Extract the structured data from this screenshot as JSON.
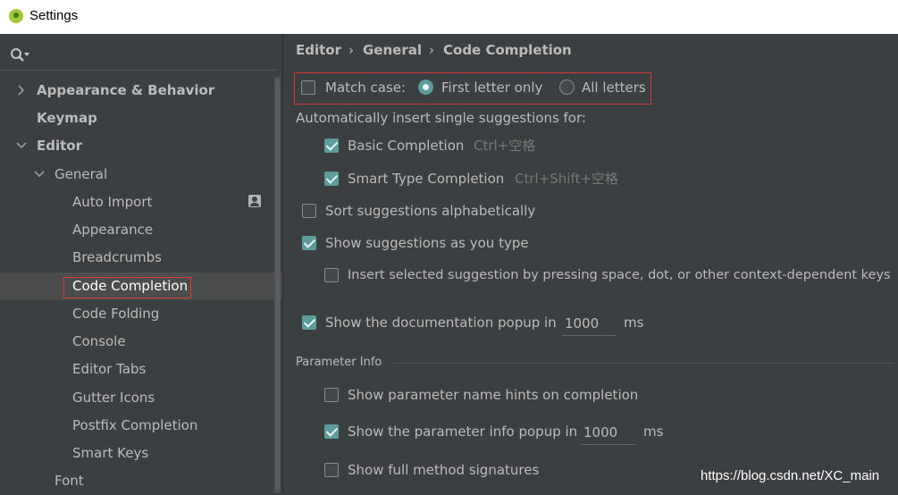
{
  "window": {
    "title": "Settings"
  },
  "sidebar": {
    "items": [
      {
        "label": "Appearance & Behavior"
      },
      {
        "label": "Keymap"
      },
      {
        "label": "Editor"
      },
      {
        "label": "General"
      },
      {
        "label": "Auto Import"
      },
      {
        "label": "Appearance"
      },
      {
        "label": "Breadcrumbs"
      },
      {
        "label": "Code Completion"
      },
      {
        "label": "Code Folding"
      },
      {
        "label": "Console"
      },
      {
        "label": "Editor Tabs"
      },
      {
        "label": "Gutter Icons"
      },
      {
        "label": "Postfix Completion"
      },
      {
        "label": "Smart Keys"
      },
      {
        "label": "Font"
      }
    ],
    "selected": "Code Completion"
  },
  "breadcrumb": [
    "Editor",
    "General",
    "Code Completion"
  ],
  "match_case": {
    "label": "Match case:",
    "checked": false,
    "options": [
      "First letter only",
      "All letters"
    ],
    "selected": "First letter only"
  },
  "auto_insert": {
    "label": "Automatically insert single suggestions for:",
    "basic": {
      "label": "Basic Completion",
      "shortcut": "Ctrl+空格",
      "checked": true
    },
    "smart": {
      "label": "Smart Type Completion",
      "shortcut": "Ctrl+Shift+空格",
      "checked": true
    }
  },
  "sort_alpha": {
    "label": "Sort suggestions alphabetically",
    "checked": false
  },
  "show_as_type": {
    "label": "Show suggestions as you type",
    "checked": true
  },
  "insert_selected": {
    "label": "Insert selected suggestion by pressing space, dot, or other context-dependent keys",
    "checked": false
  },
  "doc_popup": {
    "label": "Show the documentation popup in",
    "value": "1000",
    "unit": "ms",
    "checked": true
  },
  "parameter_info": {
    "section": "Parameter Info",
    "name_hints": {
      "label": "Show parameter name hints on completion",
      "checked": false
    },
    "info_popup": {
      "label": "Show the parameter info popup in",
      "value": "1000",
      "unit": "ms",
      "checked": true
    },
    "full_signatures": {
      "label": "Show full method signatures",
      "checked": false
    }
  },
  "watermark": "https://blog.csdn.net/XC_main",
  "colors": {
    "accent": "#5e9c9c",
    "highlight_box": "#d83a3a",
    "background": "#3c3f41"
  }
}
